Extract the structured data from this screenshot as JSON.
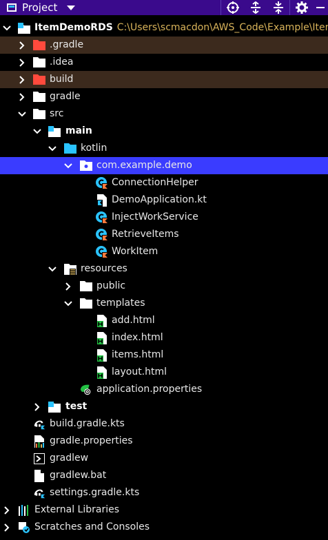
{
  "toolbar": {
    "title": "Project",
    "buttons": [
      "locate-icon",
      "expand-all-icon",
      "collapse-all-icon",
      "gear-icon",
      "hide-icon"
    ]
  },
  "tree": {
    "root": {
      "label": "ItemDemoRDS",
      "path": "C:\\Users\\scmacdon\\AWS_Code\\Example\\ItemD"
    },
    "gradle_hidden": ".gradle",
    "idea": ".idea",
    "build": "build",
    "gradle": "gradle",
    "src": "src",
    "main": "main",
    "kotlin": "kotlin",
    "package": "com.example.demo",
    "connection_helper": "ConnectionHelper",
    "demo_application": "DemoApplication.kt",
    "inject_work_service": "InjectWorkService",
    "retrieve_items": "RetrieveItems",
    "work_item": "WorkItem",
    "resources": "resources",
    "public": "public",
    "templates": "templates",
    "add_html": "add.html",
    "index_html": "index.html",
    "items_html": "items.html",
    "layout_html": "layout.html",
    "app_properties": "application.properties",
    "test": "test",
    "build_gradle_kts": "build.gradle.kts",
    "gradle_properties": "gradle.properties",
    "gradlew": "gradlew",
    "gradlew_bat": "gradlew.bat",
    "settings_gradle_kts": "settings.gradle.kts",
    "external_libraries": "External Libraries",
    "scratches": "Scratches and Consoles"
  },
  "colors": {
    "toolbar_bg": "#3a0a8c",
    "selection": "#3a3cff",
    "excluded_bg": "#3c2a1d",
    "path_text": "#d8b35a",
    "kotlin_class": "#2ac3ff",
    "html_badge": "#23c043"
  }
}
